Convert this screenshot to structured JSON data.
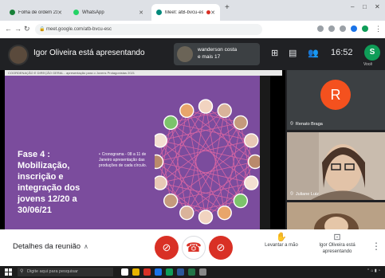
{
  "browser": {
    "tabs": [
      {
        "label": "Folha de ordem 21 - Microsoft...",
        "favicon_color": "#188038",
        "active": false
      },
      {
        "label": "WhatsApp",
        "favicon_color": "#25d366",
        "active": false
      },
      {
        "label": "Meet: atB-bvcu-esc",
        "favicon_color": "#00897b",
        "active": true,
        "recording": true
      }
    ],
    "new_tab": "+",
    "url": "meet.google.com/atb-bvcu-esc",
    "window_controls": [
      "–",
      "□",
      "✕"
    ]
  },
  "meet": {
    "presenter_banner": "Igor Oliveira está apresentando",
    "pinned_tile": {
      "line1": "wanderson costa",
      "line2": "e mais 17"
    },
    "clock": "16:52",
    "you_label": "Você",
    "you_initial": "S",
    "slide_header": "COORDENAÇÃO E DIREÇÃO GERAL - apresentação para o Jovens Protagonistas 2021",
    "slide": {
      "title_lines": [
        "Fase 4 :",
        "Mobilização,",
        "inscrição e",
        "integração dos",
        "jovens 12/20 a",
        "30/06/21"
      ],
      "bullet": "Cronograma - 08 a 11 de Janeiro apresentação das produções de cada círculo."
    },
    "participants": [
      {
        "name": "Renato Braga",
        "initial": "R",
        "avatar_color": "#f4511e"
      },
      {
        "name": "Juliane Luiz",
        "initial": ""
      },
      {
        "name": "",
        "initial": ""
      }
    ],
    "controls": {
      "meeting_details": "Detalhes da reunião",
      "raise_hand": "Levantar a mão",
      "present": "Igor Oliveira está apresentando"
    }
  },
  "taskbar": {
    "search_placeholder": "Digite aqui para pesquisar"
  }
}
